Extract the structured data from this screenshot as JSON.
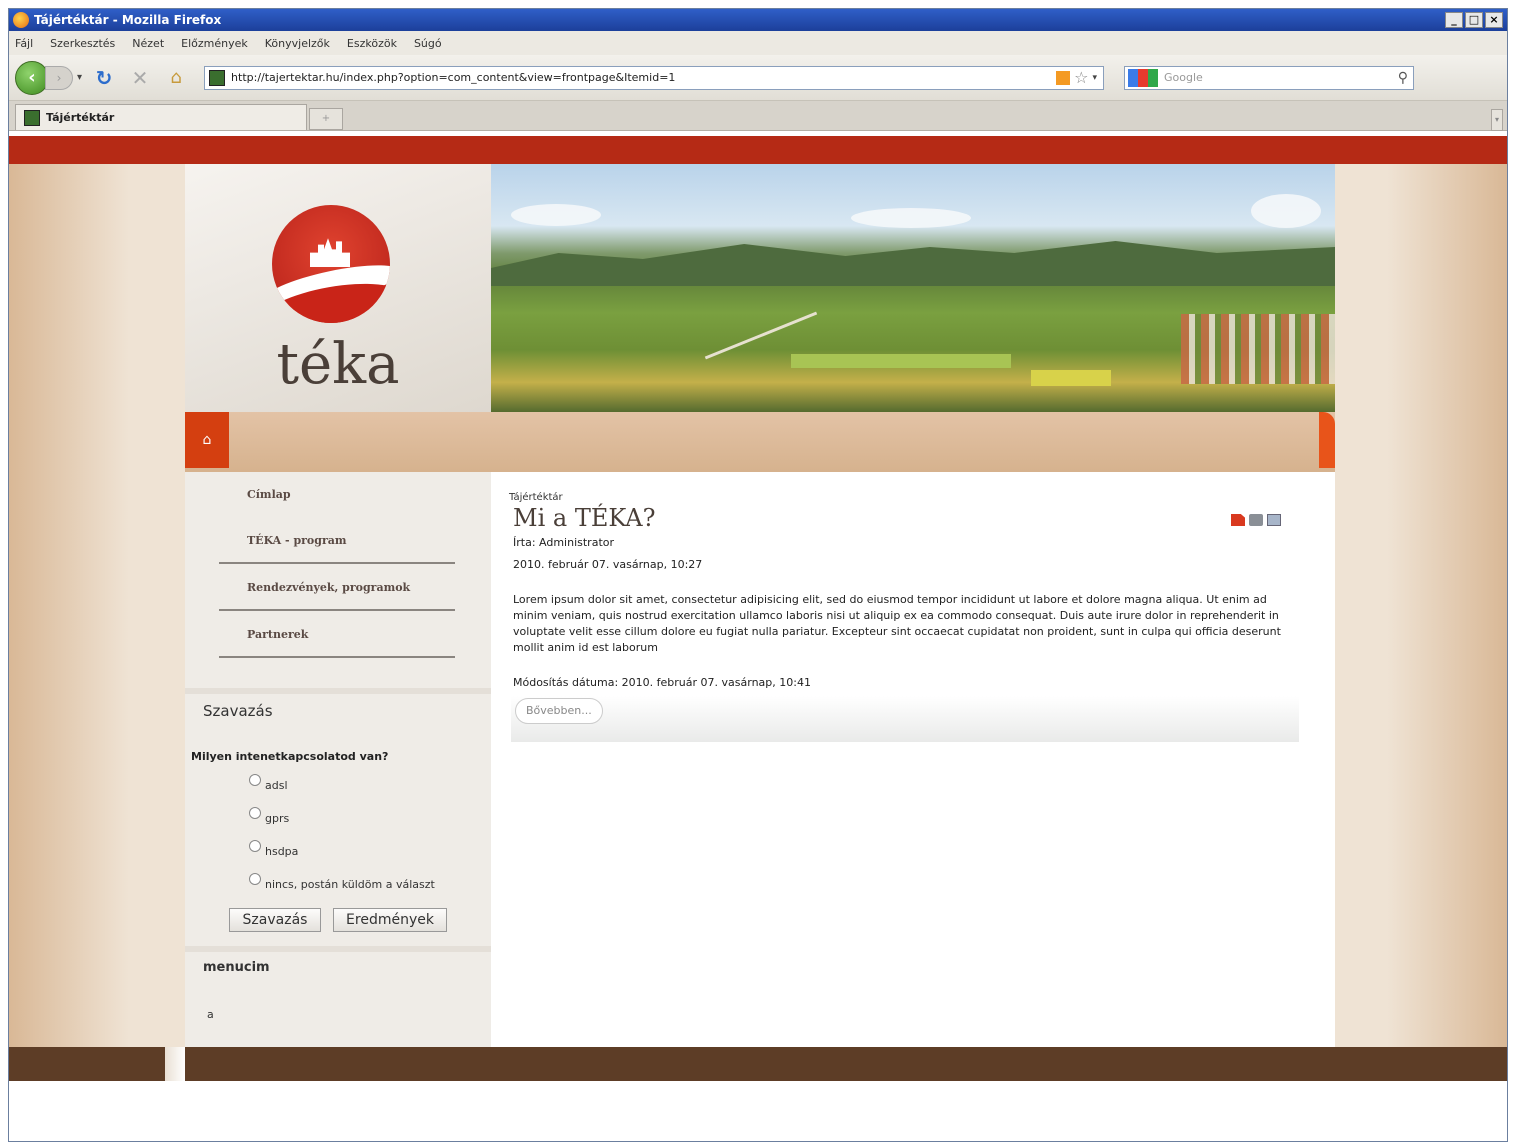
{
  "window": {
    "title": "Tájértéktár - Mozilla Firefox",
    "controls": [
      "_",
      "□",
      "×"
    ]
  },
  "menubar": [
    "Fájl",
    "Szerkesztés",
    "Nézet",
    "Előzmények",
    "Könyvjelzők",
    "Eszközök",
    "Súgó"
  ],
  "navbar": {
    "url": "http://tajertektar.hu/index.php?option=com_content&view=frontpage&Itemid=1",
    "search_placeholder": "Google"
  },
  "tab": {
    "label": "Tájértéktár"
  },
  "site": {
    "logo_text": "téka",
    "menu": [
      "Címlap",
      "TÉKA - program",
      "Rendezvények, programok",
      "Partnerek"
    ],
    "poll": {
      "title": "Szavazás",
      "question": "Milyen intenetkapcsolatod van?",
      "options": [
        "adsl",
        "gprs",
        "hsdpa",
        "nincs, postán küldöm a választ"
      ],
      "vote_button": "Szavazás",
      "results_button": "Eredmények"
    },
    "menucim": {
      "title": "menucim",
      "item": "a"
    },
    "article": {
      "breadcrumb": "Tájértéktár",
      "title": "Mi a TÉKA?",
      "author": "Írta: Administrator",
      "created": "2010. február 07. vasárnap, 10:27",
      "body": "Lorem ipsum dolor sit amet, consectetur adipisicing elit, sed do eiusmod tempor incididunt ut labore et dolore magna aliqua. Ut enim ad minim veniam, quis nostrud exercitation ullamco laboris nisi ut aliquip ex ea commodo consequat. Duis aute irure dolor in reprehenderit in voluptate velit esse cillum dolore eu fugiat nulla pariatur. Excepteur sint occaecat cupidatat non proident, sunt in culpa qui officia deserunt mollit anim id est laborum",
      "modified": "Módosítás dátuma: 2010. február 07. vasárnap, 10:41",
      "read_more": "Bővebben..."
    }
  },
  "colors": {
    "top_strip": "#b52a15",
    "home_button": "#d43f10",
    "footer": "#5d3d26",
    "page_background": "#efe3d4"
  }
}
